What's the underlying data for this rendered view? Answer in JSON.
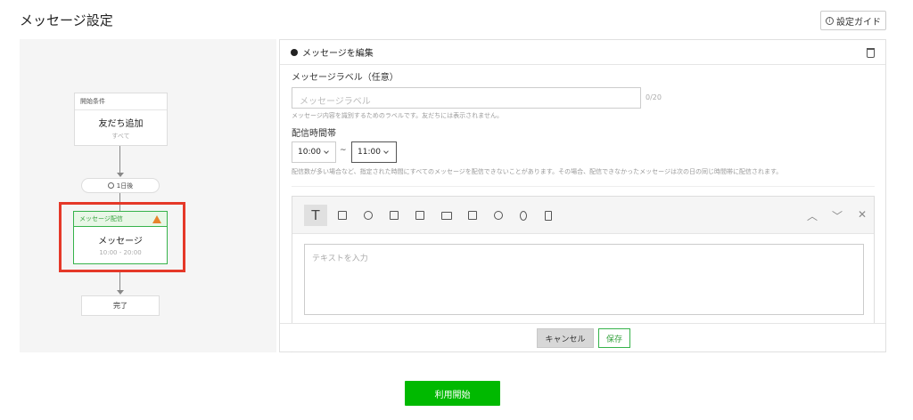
{
  "page": {
    "title": "メッセージ設定",
    "guide_label": "設定ガイド"
  },
  "flow": {
    "start_node": {
      "header": "開始条件",
      "title": "友だち追加",
      "subtitle": "すべて"
    },
    "delay": {
      "label": "1日後"
    },
    "message_node": {
      "header": "メッセージ配信",
      "title": "メッセージ",
      "subtitle": "10:00 - 20:00"
    },
    "end_node": {
      "label": "完了"
    }
  },
  "editor": {
    "heading": "メッセージを編集",
    "label_field": {
      "label": "メッセージラベル（任意）",
      "placeholder": "メッセージラベル",
      "counter": "0/20",
      "help": "メッセージ内容を識別するためのラベルです。友だちには表示されません。"
    },
    "time_window": {
      "label": "配信時間帯",
      "start": "10:00",
      "separator": "~",
      "end": "11:00",
      "help": "配信数が多い場合など、指定された時間にすべてのメッセージを配信できないことがあります。その場合、配信できなかったメッセージは次の日の同じ時間帯に配信されます。"
    },
    "toolbar": {
      "text_tool_glyph": "T",
      "tools": [
        "text-icon",
        "image-icon",
        "sticker-icon",
        "coupon-icon",
        "video-icon",
        "card-icon",
        "rich-video-icon",
        "emoji-icon",
        "audio-icon",
        "survey-icon"
      ]
    },
    "text_area": {
      "placeholder": "テキストを入力"
    },
    "cancel_label": "キャンセル",
    "save_label": "保存"
  },
  "start_button": {
    "label": "利用開始"
  },
  "colors": {
    "brand_green": "#00b900",
    "accent_green": "#36b34a",
    "highlight_red": "#e53828",
    "warning_orange": "#e8832c"
  }
}
